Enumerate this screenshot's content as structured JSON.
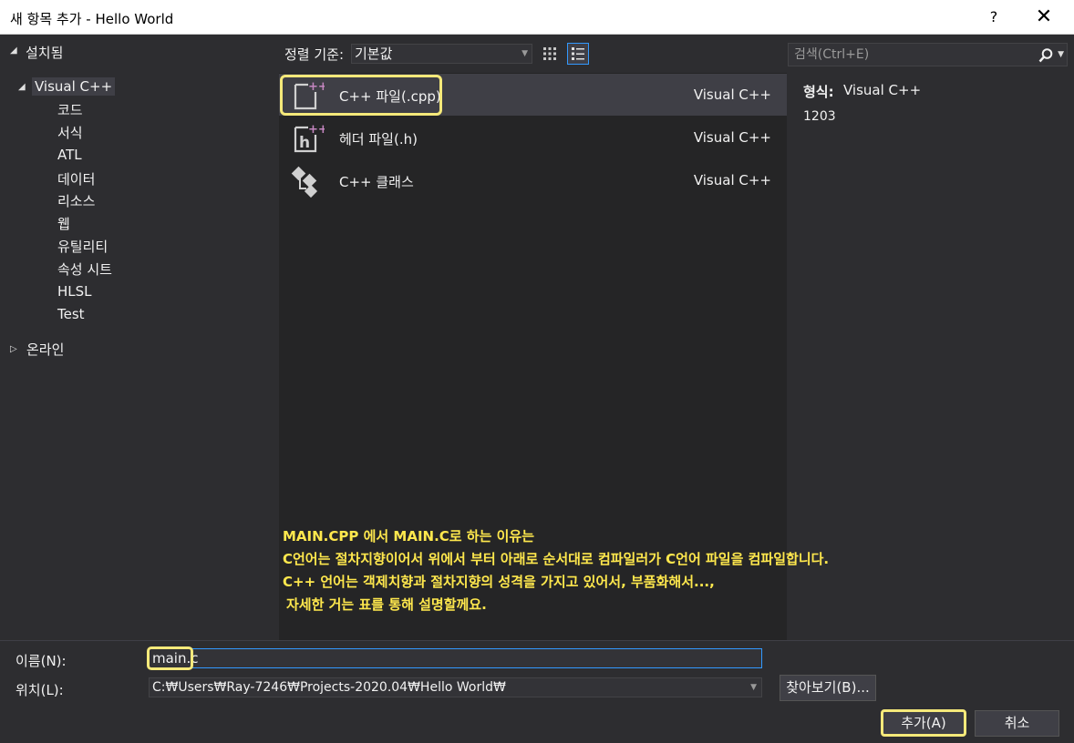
{
  "window": {
    "title": "새 항목 추가 - Hello World",
    "help_label": "?",
    "close_label": "✕"
  },
  "tree": {
    "installed_label": "설치됨",
    "root_label": "Visual C++",
    "children": [
      "코드",
      "서식",
      "ATL",
      "데이터",
      "리소스",
      "웹",
      "유틸리티",
      "속성 시트",
      "HLSL",
      "Test"
    ],
    "online_label": "온라인"
  },
  "toolbar": {
    "sort_label": "정렬 기준:",
    "sort_value": "기본값",
    "search_placeholder": "검색(Ctrl+E)"
  },
  "items": [
    {
      "name": "C++ 파일(.cpp)",
      "lang": "Visual C++",
      "icon": "cpp-file-icon",
      "selected": true
    },
    {
      "name": "헤더 파일(.h)",
      "lang": "Visual C++",
      "icon": "header-file-icon",
      "selected": false
    },
    {
      "name": "C++ 클래스",
      "lang": "Visual C++",
      "icon": "class-icon",
      "selected": false
    }
  ],
  "annotation": [
    "MAIN.CPP 에서 MAIN.C로 하는 이유는",
    "C언어는 절차지향이어서 위에서 부터 아래로 순서대로 컴파일러가 C언어 파일을 컴파일합니다.",
    "C++ 언어는 객제치향과 절차지향의 성격을 가지고 있어서, 부품화해서...,",
    "자세한 거는 표를 통해 설명할께요."
  ],
  "details": {
    "type_label": "형식:",
    "type_value": "Visual C++",
    "number": "1203"
  },
  "form": {
    "name_label": "이름(N):",
    "name_value": "main.c",
    "location_label": "위치(L):",
    "location_value": "C:₩Users₩Ray-7246₩Projects-2020.04₩Hello World₩",
    "browse_label": "찾아보기(B)...",
    "add_label": "추가(A)",
    "cancel_label": "취소"
  },
  "colors": {
    "background": "#2d2d30",
    "list_background": "#252526",
    "highlight": "#f5e97a",
    "annotation": "#ffe84d",
    "accent": "#3399ff"
  }
}
